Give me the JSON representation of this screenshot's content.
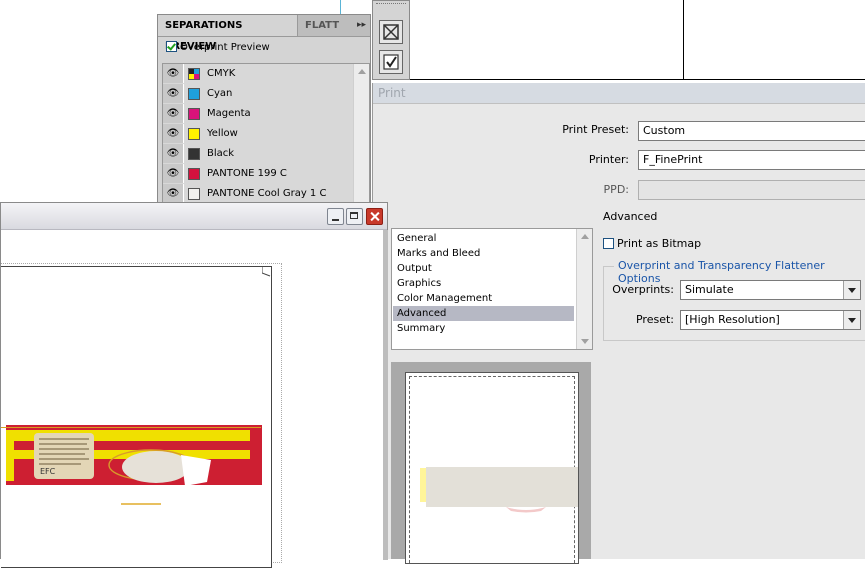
{
  "separations_panel": {
    "tab_active": "SEPARATIONS PREVIEW",
    "tab_inactive": "FLATT",
    "menu_glyph": "▸▸",
    "overprint_preview_label": "Overprint Preview",
    "overprint_preview_checked": true,
    "eye_glyph": "👁",
    "rows": [
      {
        "name": "CMYK",
        "color": "cmyk"
      },
      {
        "name": "Cyan",
        "color": "#1fa0dc"
      },
      {
        "name": "Magenta",
        "color": "#d9137a"
      },
      {
        "name": "Yellow",
        "color": "#fff200"
      },
      {
        "name": "Black",
        "color": "#333333"
      },
      {
        "name": "PANTONE 199 C",
        "color": "#d4123e"
      },
      {
        "name": "PANTONE Cool Gray 1 C",
        "color": "#f2f1ee"
      }
    ]
  },
  "print_dialog": {
    "title": "Print",
    "print_preset_label": "Print Preset:",
    "print_preset_value": "Custom",
    "printer_label": "Printer:",
    "printer_value": "F_FinePrint",
    "ppd_label": "PPD:",
    "ppd_value": "",
    "section_title": "Advanced",
    "print_as_bitmap_label": "Print as Bitmap",
    "print_as_bitmap_checked": false,
    "group_title": "Overprint and Transparency Flattener Options",
    "overprints_label": "Overprints:",
    "overprints_value": "Simulate",
    "preset_label": "Preset:",
    "preset_value": "[High Resolution]",
    "categories": [
      "General",
      "Marks and Bleed",
      "Output",
      "Graphics",
      "Color Management",
      "Advanced",
      "Summary"
    ],
    "selected_category": "Advanced"
  },
  "document_window": {
    "label_text": "EFC"
  },
  "colors": {
    "artwork_red": "#cd1f32",
    "artwork_yellow": "#f0e000",
    "artwork_beige": "#e6e1d8"
  }
}
